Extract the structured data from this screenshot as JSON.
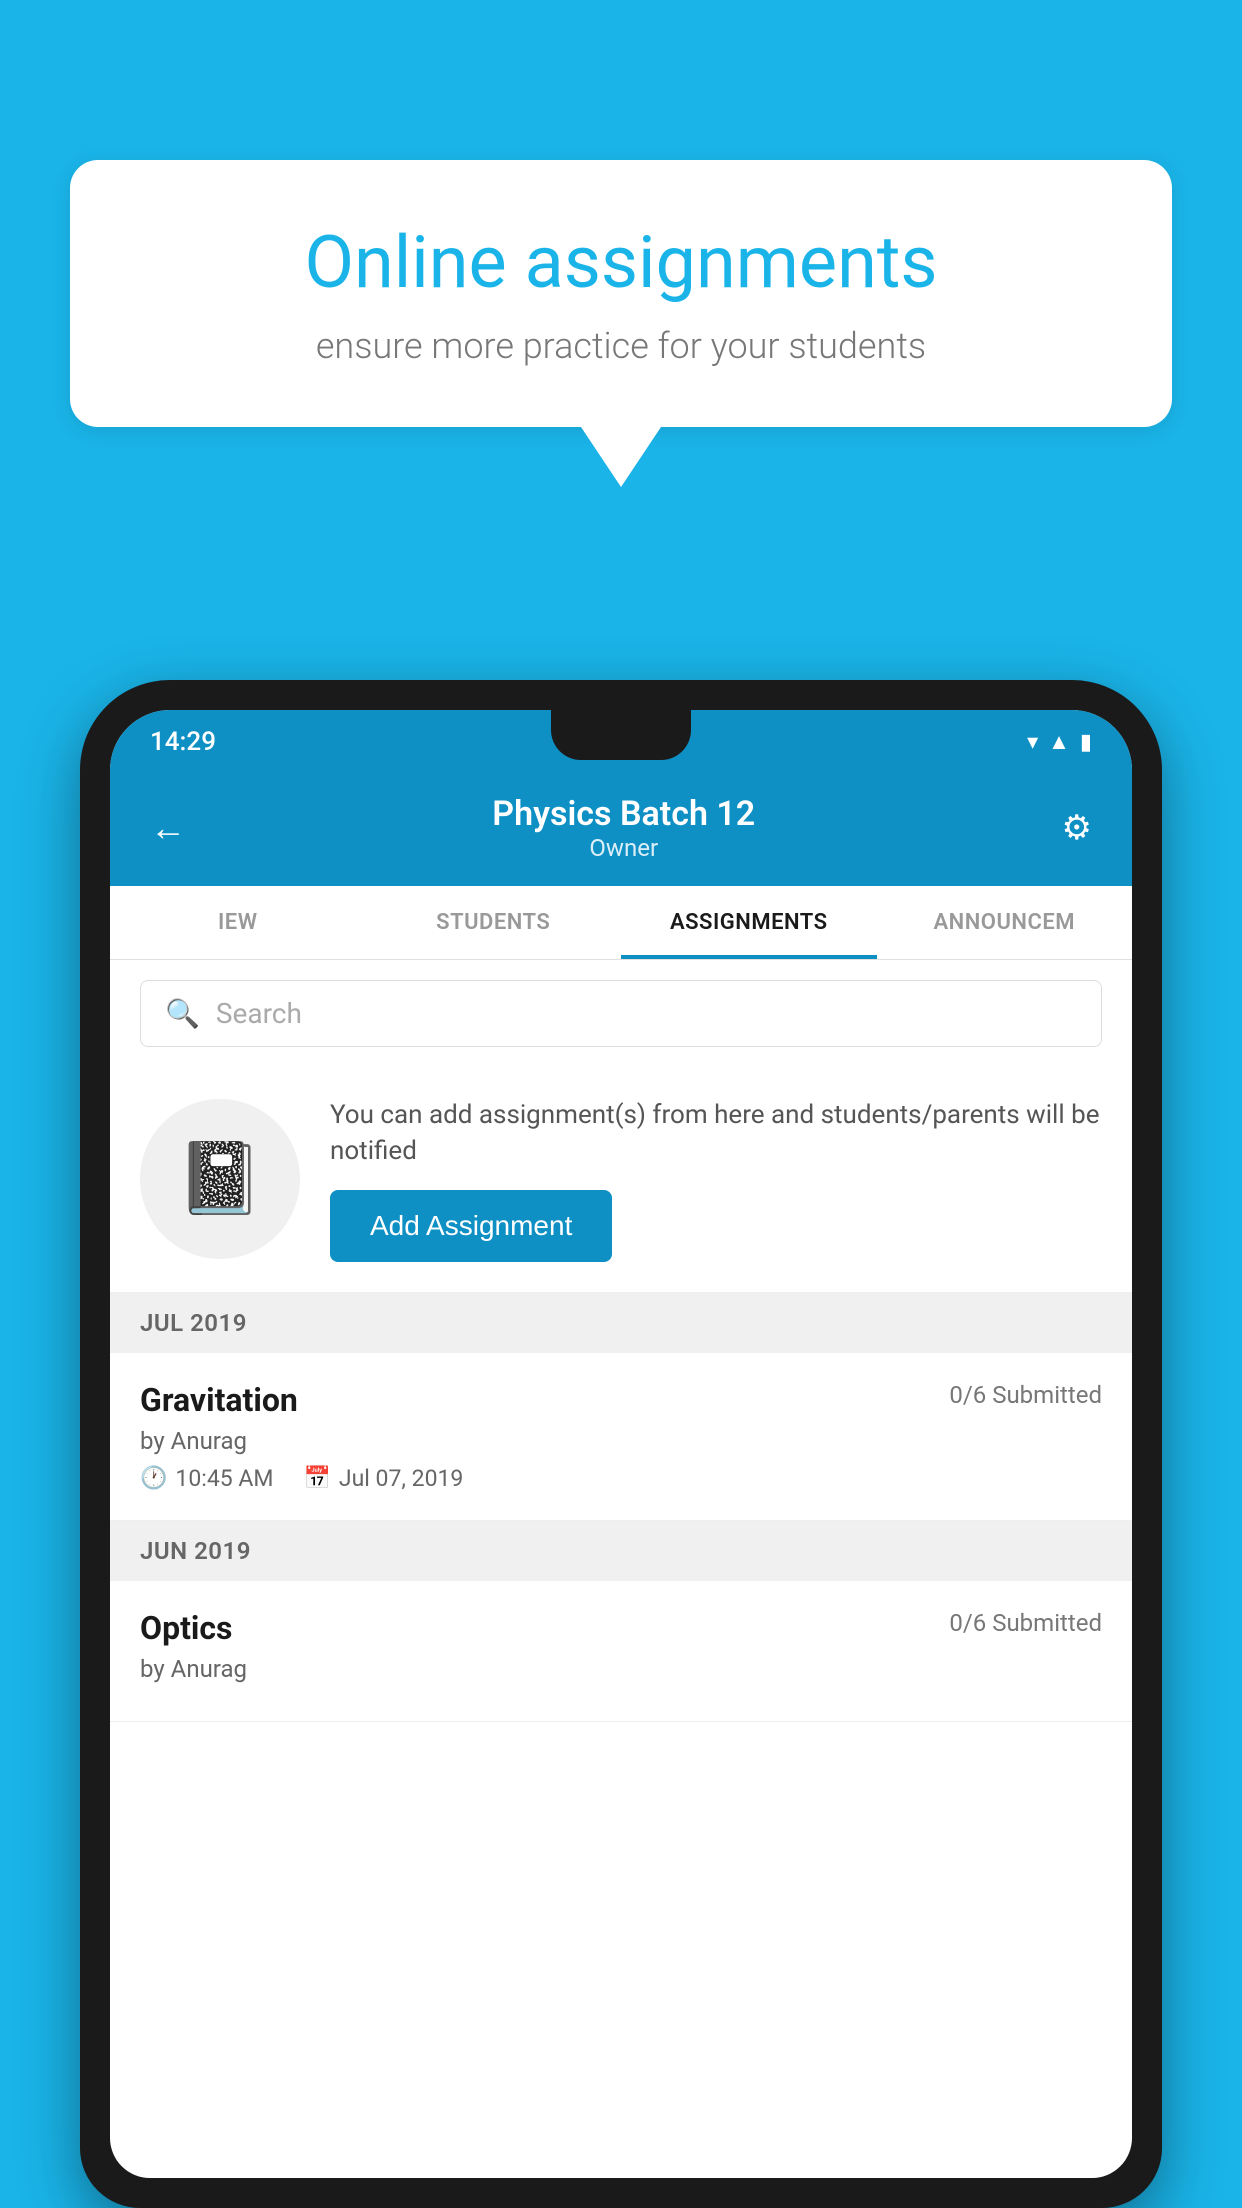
{
  "background_color": "#1ab4e8",
  "speech_bubble": {
    "title": "Online assignments",
    "subtitle": "ensure more practice for your students"
  },
  "status_bar": {
    "time": "14:29",
    "wifi_icon": "▾",
    "signal_icon": "▲",
    "battery_icon": "▮"
  },
  "app_header": {
    "back_icon": "←",
    "title": "Physics Batch 12",
    "subtitle": "Owner",
    "settings_icon": "⚙"
  },
  "tabs": [
    {
      "label": "IEW",
      "active": false
    },
    {
      "label": "STUDENTS",
      "active": false
    },
    {
      "label": "ASSIGNMENTS",
      "active": true
    },
    {
      "label": "ANNOUNCEM",
      "active": false
    }
  ],
  "search": {
    "placeholder": "Search"
  },
  "add_assignment_promo": {
    "description": "You can add assignment(s) from here and students/parents will be notified",
    "button_label": "Add Assignment"
  },
  "months": [
    {
      "label": "JUL 2019",
      "assignments": [
        {
          "name": "Gravitation",
          "submitted": "0/6 Submitted",
          "author": "by Anurag",
          "time": "10:45 AM",
          "date": "Jul 07, 2019"
        }
      ]
    },
    {
      "label": "JUN 2019",
      "assignments": [
        {
          "name": "Optics",
          "submitted": "0/6 Submitted",
          "author": "by Anurag",
          "time": "",
          "date": ""
        }
      ]
    }
  ]
}
